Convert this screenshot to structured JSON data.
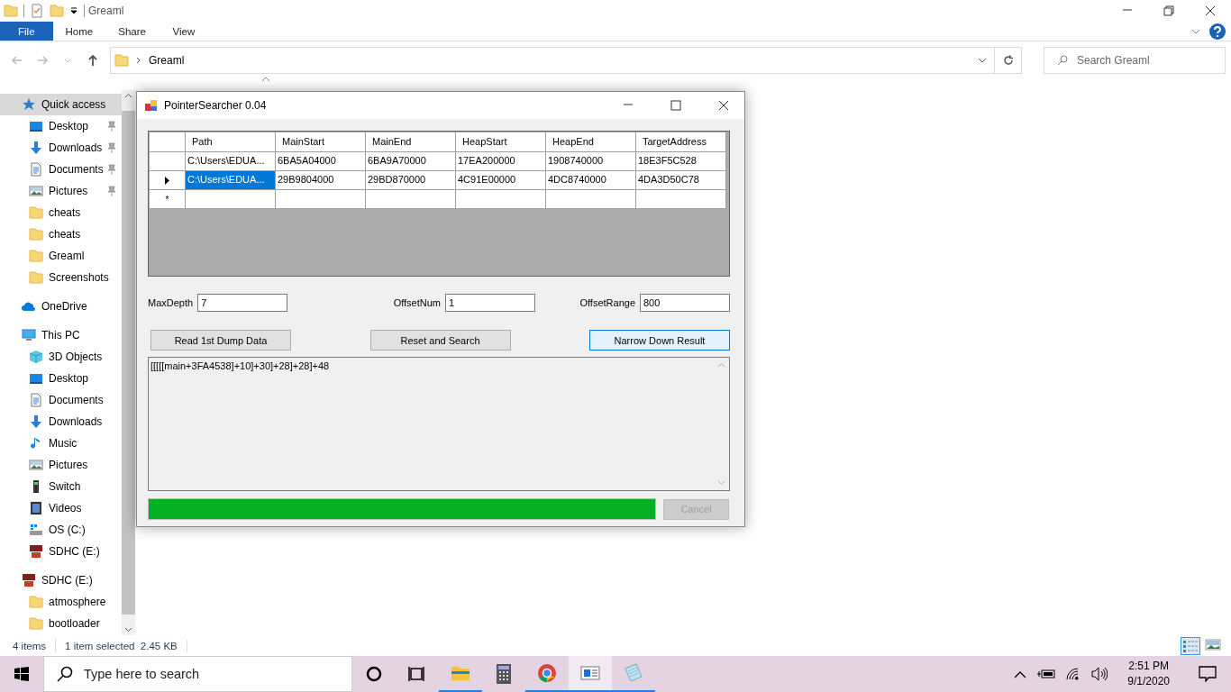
{
  "explorer": {
    "title": "Greaml",
    "ribbon_tabs": [
      {
        "label": "File",
        "selected": true
      },
      {
        "label": "Home",
        "selected": false
      },
      {
        "label": "Share",
        "selected": false
      },
      {
        "label": "View",
        "selected": false
      }
    ],
    "address": {
      "path": "Greaml"
    },
    "search": {
      "placeholder": "Search Greaml"
    },
    "nav": [
      {
        "label": "Quick access",
        "kind": "star",
        "selected": true,
        "children": [
          {
            "label": "Desktop",
            "kind": "desktop",
            "pinned": true
          },
          {
            "label": "Downloads",
            "kind": "download",
            "pinned": true
          },
          {
            "label": "Documents",
            "kind": "document",
            "pinned": true
          },
          {
            "label": "Pictures",
            "kind": "pictures",
            "pinned": true
          },
          {
            "label": "cheats",
            "kind": "folder",
            "pinned": false
          },
          {
            "label": "cheats",
            "kind": "folder",
            "pinned": false
          },
          {
            "label": "Greaml",
            "kind": "folder",
            "pinned": false
          },
          {
            "label": "Screenshots",
            "kind": "folder",
            "pinned": false
          }
        ]
      },
      {
        "label": "OneDrive",
        "kind": "cloud",
        "selected": false
      },
      {
        "label": "This PC",
        "kind": "pc",
        "selected": false,
        "children": [
          {
            "label": "3D Objects",
            "kind": "cube"
          },
          {
            "label": "Desktop",
            "kind": "desktop"
          },
          {
            "label": "Documents",
            "kind": "document"
          },
          {
            "label": "Downloads",
            "kind": "download"
          },
          {
            "label": "Music",
            "kind": "music"
          },
          {
            "label": "Pictures",
            "kind": "pictures"
          },
          {
            "label": "Switch",
            "kind": "switch"
          },
          {
            "label": "Videos",
            "kind": "video"
          },
          {
            "label": "OS (C:)",
            "kind": "drive"
          },
          {
            "label": "SDHC (E:)",
            "kind": "sd"
          }
        ]
      },
      {
        "label": "SDHC (E:)",
        "kind": "sd",
        "selected": false,
        "children": [
          {
            "label": "atmosphere",
            "kind": "folder"
          },
          {
            "label": "bootloader",
            "kind": "folder"
          }
        ]
      }
    ],
    "status_bar": {
      "item_count": "4 items",
      "selection": "1 item selected  2.45 KB"
    }
  },
  "dialog": {
    "title": "PointerSearcher 0.04",
    "grid": {
      "columns": [
        "Path",
        "MainStart",
        "MainEnd",
        "HeapStart",
        "HeapEnd",
        "TargetAddress"
      ],
      "rows": [
        {
          "current": false,
          "cells": [
            {
              "text": "C:\\Users\\EDUA...",
              "selected": false
            },
            {
              "text": "6BA5A04000",
              "selected": false
            },
            {
              "text": "6BA9A70000",
              "selected": false
            },
            {
              "text": "17EA200000",
              "selected": false
            },
            {
              "text": "1908740000",
              "selected": false
            },
            {
              "text": "18E3F5C528",
              "selected": false
            }
          ]
        },
        {
          "current": true,
          "cells": [
            {
              "text": "C:\\Users\\EDUA...",
              "selected": true
            },
            {
              "text": "29B9804000",
              "selected": false
            },
            {
              "text": "29BD870000",
              "selected": false
            },
            {
              "text": "4C91E00000",
              "selected": false
            },
            {
              "text": "4DC8740000",
              "selected": false
            },
            {
              "text": "4DA3D50C78",
              "selected": false
            }
          ]
        }
      ],
      "new_row_marker": "*"
    },
    "fields": [
      {
        "label": "MaxDepth",
        "value": "7"
      },
      {
        "label": "OffsetNum",
        "value": "1"
      },
      {
        "label": "OffsetRange",
        "value": "800"
      }
    ],
    "buttons": [
      {
        "label": "Read 1st Dump Data",
        "focused": false
      },
      {
        "label": "Reset and Search",
        "focused": false
      },
      {
        "label": "Narrow Down Result",
        "focused": true
      }
    ],
    "output": "[[[[[main+3FA4538]+10]+30]+28]+28]+48",
    "progress": {
      "level": 1.0
    },
    "cancel": {
      "label": "Cancel",
      "disabled": true
    }
  },
  "taskbar": {
    "search_placeholder": "Type here to search",
    "apps": [
      {
        "kind": "cortana",
        "running": false,
        "active": false
      },
      {
        "kind": "taskview",
        "running": false,
        "active": false
      },
      {
        "kind": "explorer",
        "running": true,
        "active": false
      },
      {
        "kind": "calculator",
        "running": false,
        "active": false
      },
      {
        "kind": "chrome",
        "running": true,
        "active": false
      },
      {
        "kind": "app",
        "running": true,
        "active": true
      },
      {
        "kind": "notepad",
        "running": true,
        "active": false
      }
    ],
    "time": "2:51 PM",
    "date": "9/1/2020"
  }
}
